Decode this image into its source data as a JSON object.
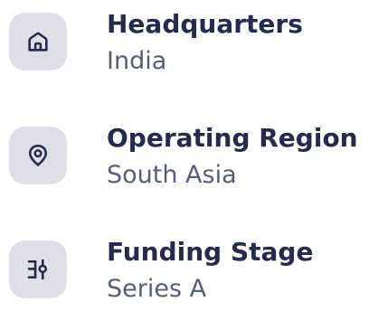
{
  "colors": {
    "title": "#262a4b",
    "value": "#585c76",
    "icon_bg": "#dedfe8",
    "icon_stroke": "#262a4b"
  },
  "items": [
    {
      "icon": "home-icon",
      "title": "Headquarters",
      "value": "India"
    },
    {
      "icon": "location-pin-icon",
      "title": "Operating Region",
      "value": "South Asia"
    },
    {
      "icon": "sliders-icon",
      "title": "Funding Stage",
      "value": "Series A"
    }
  ]
}
